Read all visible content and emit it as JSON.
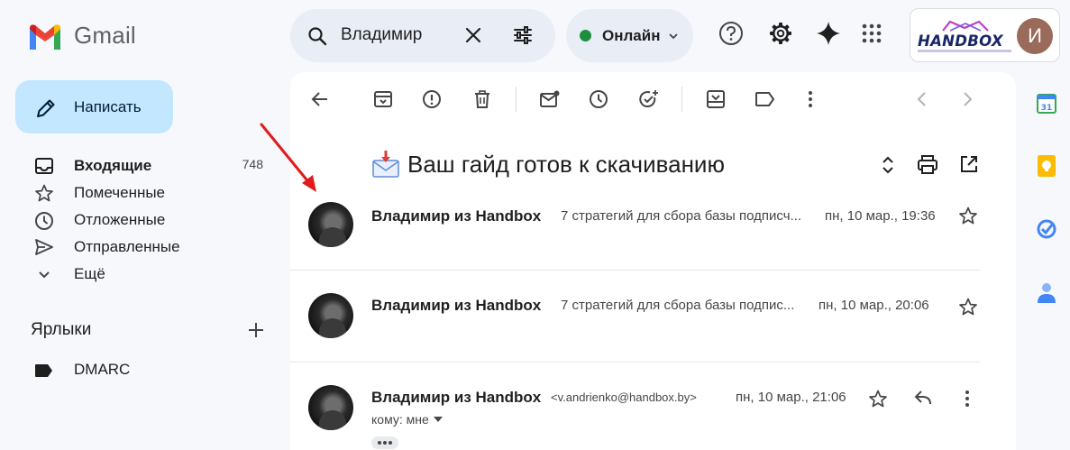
{
  "app": {
    "name": "Gmail"
  },
  "search": {
    "query": "Владимир"
  },
  "status": {
    "label": "Онлайн",
    "color": "#1e8e3e"
  },
  "account": {
    "brand": "HANDBOX",
    "avatar_letter": "И"
  },
  "compose": {
    "label": "Написать"
  },
  "nav": {
    "items": [
      {
        "label": "Входящие",
        "count": "748"
      },
      {
        "label": "Помеченные"
      },
      {
        "label": "Отложенные"
      },
      {
        "label": "Отправленные"
      },
      {
        "label": "Ещё"
      }
    ],
    "labels_title": "Ярлыки",
    "labels": [
      {
        "label": "DMARC"
      }
    ]
  },
  "thread": {
    "subject": "Ваш гайд готов к скачиванию",
    "messages": [
      {
        "sender": "Владимир из Handbox",
        "snippet": "7 стратегий для сбора базы подписч...",
        "date": "пн, 10 мар., 19:36"
      },
      {
        "sender": "Владимир из Handbox",
        "snippet": "7 стратегий для сбора базы подпис...",
        "date": "пн, 10 мар., 20:06"
      },
      {
        "sender": "Владимир из Handbox",
        "email": "<v.andrienko@handbox.by>",
        "date": "пн, 10 мар., 21:06",
        "to": "кому: мне"
      }
    ]
  },
  "colors": {
    "accent": "#c2e7ff",
    "background": "#f6f8fc",
    "annotation": "#e01b1b"
  }
}
